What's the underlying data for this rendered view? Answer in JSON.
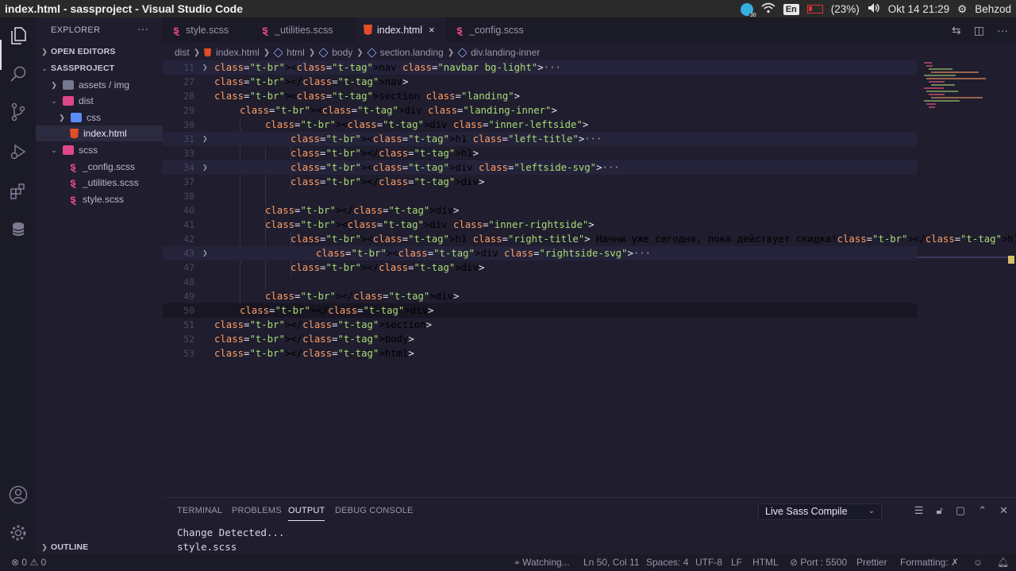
{
  "window_title": "index.html - sassproject - Visual Studio Code",
  "system_tray": {
    "telegram_badge": "30",
    "keyboard_layout": "En",
    "battery": "(23%)",
    "datetime": "Okt 14 21:29",
    "user": "Behzod"
  },
  "sidebar": {
    "header": "EXPLORER",
    "more": "···",
    "open_editors": "OPEN EDITORS",
    "project": "SASSPROJECT",
    "items": [
      {
        "label": "assets / img"
      },
      {
        "label": "dist"
      },
      {
        "label": "css"
      },
      {
        "label": "index.html"
      },
      {
        "label": "scss"
      },
      {
        "label": "_config.scss"
      },
      {
        "label": "_utilities.scss"
      },
      {
        "label": "style.scss"
      }
    ],
    "outline": "OUTLINE"
  },
  "tabs": [
    {
      "label": "style.scss"
    },
    {
      "label": "_utilities.scss"
    },
    {
      "label": "index.html",
      "close": "×"
    },
    {
      "label": "_config.scss"
    }
  ],
  "breadcrumb": [
    "dist",
    "index.html",
    "html",
    "body",
    "section.landing",
    "div.landing-inner"
  ],
  "editor": {
    "lines": [
      {
        "n": "11",
        "t": "<nav class=\"navbar bg-light\">"
      },
      {
        "n": "27",
        "t": "</nav>"
      },
      {
        "n": "28",
        "t": "<section class=\"landing\">"
      },
      {
        "n": "29",
        "t": "<div class=\"landing-inner\">"
      },
      {
        "n": "30",
        "t": "<div class=\"inner-leftside\">"
      },
      {
        "n": "31",
        "t": "<h1 class=\"left-title\">"
      },
      {
        "n": "33",
        "t": "</h1>"
      },
      {
        "n": "34",
        "t": "<div class=\"leftside-svg\">"
      },
      {
        "n": "37",
        "t": "</div>"
      },
      {
        "n": "38",
        "t": ""
      },
      {
        "n": "40",
        "t": "</div>"
      },
      {
        "n": "41",
        "t": "<div class=\"inner-rightside\">"
      },
      {
        "n": "42",
        "t": "<h1 class=\"right-title\"> Начни уже сегодня, пока действует скидка!</h1>"
      },
      {
        "n": "43",
        "t": "<div class=\"rightside-svg\">"
      },
      {
        "n": "47",
        "t": "</div>"
      },
      {
        "n": "48",
        "t": ""
      },
      {
        "n": "49",
        "t": "</div>"
      },
      {
        "n": "50",
        "t": "</div>"
      },
      {
        "n": "51",
        "t": "</section>"
      },
      {
        "n": "52",
        "t": "</body>"
      },
      {
        "n": "53",
        "t": "</html>"
      }
    ],
    "folded_ellipsis": "···"
  },
  "panel": {
    "tabs": [
      "TERMINAL",
      "PROBLEMS",
      "OUTPUT",
      "DEBUG CONSOLE"
    ],
    "active_tab": "OUTPUT",
    "dropdown_value": "Live Sass Compile",
    "output": [
      "Change Detected...",
      "style.scss"
    ]
  },
  "statusbar": {
    "errors": "0",
    "warnings": "0",
    "watching": "Watching...",
    "position": "Ln 50, Col 11",
    "spaces": "Spaces: 4",
    "encoding": "UTF-8",
    "eol": "LF",
    "language": "HTML",
    "port": "Port : 5500",
    "prettier": "Prettier",
    "formatting": "Formatting: ✗"
  },
  "colors": {
    "background": "#1f1d2e",
    "tag": "#ff6188",
    "attribute": "#ff9e64",
    "string": "#a9dc76",
    "sass": "#e0468a",
    "html": "#e44d26"
  }
}
